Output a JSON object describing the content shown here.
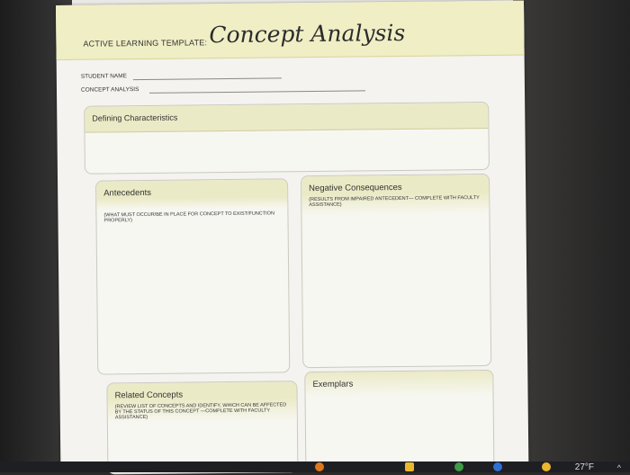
{
  "document": {
    "template_label": "ACTIVE LEARNING TEMPLATE:",
    "title": "Concept Analysis",
    "fields": {
      "student_name": "STUDENT NAME",
      "concept_analysis": "CONCEPT ANALYSIS"
    },
    "sections": {
      "defining": {
        "title": "Defining Characteristics"
      },
      "antecedents": {
        "title": "Antecedents",
        "note": "(WHAT MUST OCCUR/BE IN PLACE FOR CONCEPT TO EXIST/FUNCTION PROPERLY)"
      },
      "negative": {
        "title": "Negative Consequences",
        "note": "(RESULTS FROM IMPAIRED ANTECEDENT— COMPLETE WITH FACULTY ASSISTANCE)"
      },
      "related": {
        "title": "Related Concepts",
        "note": "(REVIEW LIST OF CONCEPTS AND IDENTIFY, WHICH CAN BE AFFECTED BY THE STATUS OF THIS CONCEPT —COMPLETE WITH FACULTY ASSISTANCE)"
      },
      "exemplars": {
        "title": "Exemplars"
      }
    }
  },
  "taskbar": {
    "weather": "27°F",
    "icons": [
      "file-explorer-icon",
      "chrome-icon",
      "help-icon",
      "weather-icon"
    ],
    "colors": {
      "orange": "#e0761c",
      "yellow": "#e9b82c",
      "blue": "#2f6fd6",
      "green": "#3e9b46"
    }
  }
}
